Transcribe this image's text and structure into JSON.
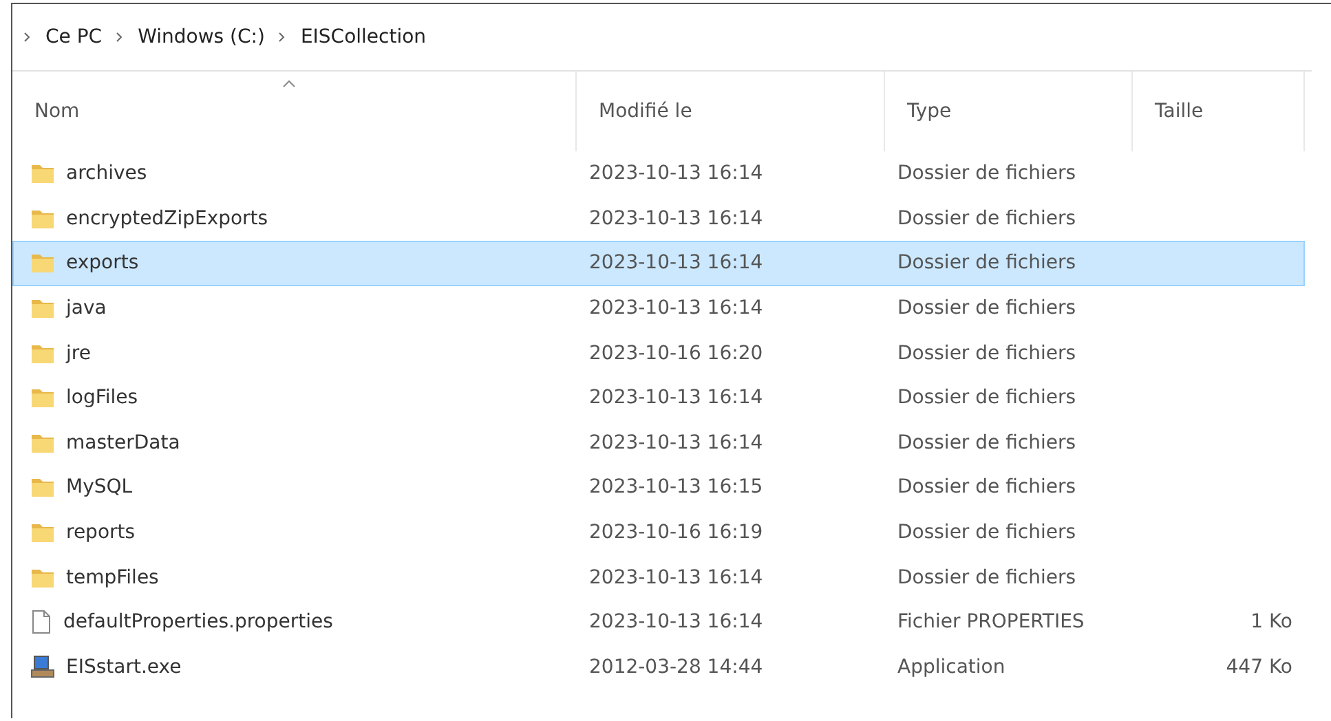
{
  "breadcrumb": {
    "items": [
      "Ce PC",
      "Windows (C:)",
      "EISCollection"
    ]
  },
  "table": {
    "columns": [
      {
        "label": "Nom",
        "sorted": true
      },
      {
        "label": "Modifié le",
        "sorted": false
      },
      {
        "label": "Type",
        "sorted": false
      },
      {
        "label": "Taille",
        "sorted": false
      }
    ],
    "rows": [
      {
        "kind": "folder",
        "name": "archives",
        "modified": "2023-10-13 16:14",
        "type": "Dossier de fichiers",
        "selected": false
      },
      {
        "kind": "folder",
        "name": "encryptedZipExports",
        "modified": "2023-10-13 16:14",
        "type": "Dossier de fichiers",
        "selected": false
      },
      {
        "kind": "folder",
        "name": "exports",
        "modified": "2023-10-13 16:14",
        "type": "Dossier de fichiers",
        "selected": true
      },
      {
        "kind": "folder",
        "name": "java",
        "modified": "2023-10-13 16:14",
        "type": "Dossier de fichiers",
        "selected": false
      },
      {
        "kind": "folder",
        "name": "jre",
        "modified": "2023-10-16 16:20",
        "type": "Dossier de fichiers",
        "selected": false
      },
      {
        "kind": "folder",
        "name": "logFiles",
        "modified": "2023-10-13 16:14",
        "type": "Dossier de fichiers",
        "selected": false
      },
      {
        "kind": "folder",
        "name": "masterData",
        "modified": "2023-10-13 16:14",
        "type": "Dossier de fichiers",
        "selected": false
      },
      {
        "kind": "folder",
        "name": "MySQL",
        "modified": "2023-10-13 16:15",
        "type": "Dossier de fichiers",
        "selected": false
      },
      {
        "kind": "folder",
        "name": "reports",
        "modified": "2023-10-16 16:19",
        "type": "Dossier de fichiers",
        "selected": false
      },
      {
        "kind": "folder",
        "name": "tempFiles",
        "modified": "2023-10-13 16:14",
        "type": "Dossier de fichiers",
        "selected": false
      },
      {
        "kind": "file",
        "name": "defaultProperties.properties",
        "modified": "2023-10-13 16:14",
        "type": "Fichier PROPERTIES",
        "size": "1 Ko",
        "selected": false
      },
      {
        "kind": "exe",
        "name": "EISstart.exe",
        "modified": "2012-03-28 14:44",
        "type": "Application",
        "size": "447 Ko",
        "selected": false
      }
    ]
  }
}
